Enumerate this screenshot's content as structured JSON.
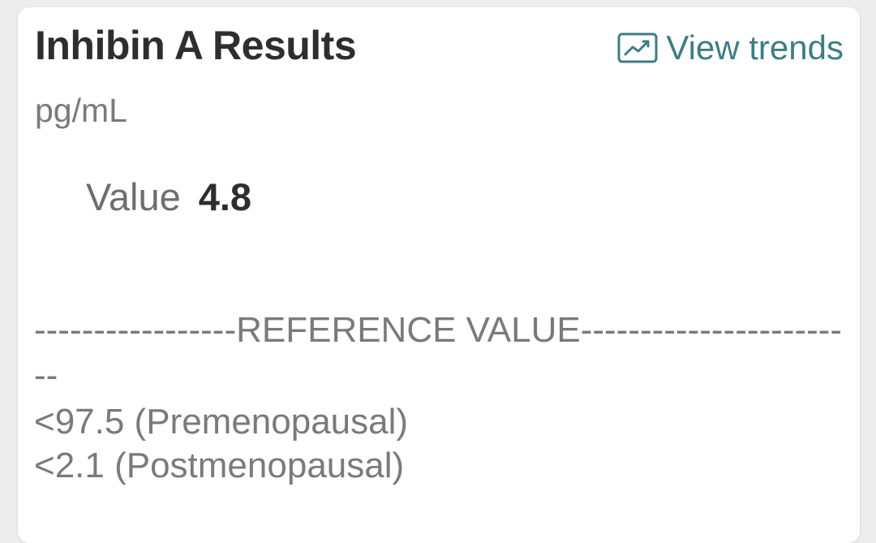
{
  "card": {
    "title": "Inhibin A Results",
    "unit": "pg/mL",
    "view_trends_label": "View trends",
    "view_trends_icon": "trend-chart-icon",
    "accent_color": "#3d7d85"
  },
  "result": {
    "label": "Value",
    "value": "4.8"
  },
  "reference": {
    "header": "-----------------REFERENCE VALUE------------------------",
    "lines": [
      "<97.5 (Premenopausal)",
      "<2.1 (Postmenopausal)"
    ]
  }
}
